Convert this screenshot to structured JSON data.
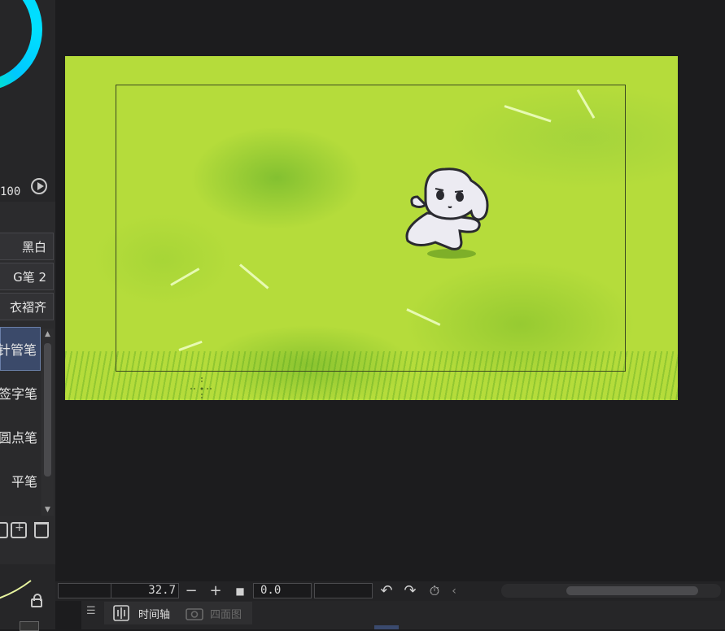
{
  "color_panel": {
    "opacity_value": "100"
  },
  "brush_tabs": [
    "黑白",
    "G笔 2",
    "衣褶齐"
  ],
  "brush_list": [
    "针管笔",
    "签字笔",
    "圆点笔",
    "平笔"
  ],
  "timeline_bar": {
    "zoom_value": "32.7",
    "rotation_value": "0.0",
    "zoom_out_label": "−",
    "zoom_in_label": "+",
    "stop_label": "■",
    "undo_label": "↶",
    "redo_label": "↷",
    "prev_label": "‹"
  },
  "bottom_tabs": {
    "timeline_label": "时间轴",
    "four_view_label": "四面图"
  },
  "colors": {
    "canvas_bg": "#b5dc3b",
    "panel_bg": "#2b2b2d",
    "workspace_bg": "#1c1c1e",
    "accent": "#3b4a6a"
  }
}
